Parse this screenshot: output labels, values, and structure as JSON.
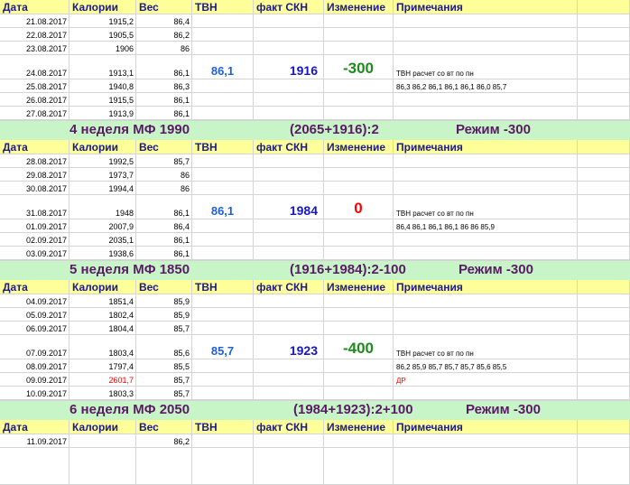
{
  "columns": [
    "Дата",
    "Калории",
    "Вес",
    "ТВН",
    "факт СКН",
    "Изменение",
    "Примечания"
  ],
  "blocks": [
    {
      "week": null,
      "rows": [
        {
          "date": "21.08.2017",
          "cal": "1915,2",
          "weight": "86,4"
        },
        {
          "date": "22.08.2017",
          "cal": "1905,5",
          "weight": "86,2"
        },
        {
          "date": "23.08.2017",
          "cal": "1906",
          "weight": "86"
        },
        {
          "date": "24.08.2017",
          "cal": "1913,1",
          "weight": "86,1",
          "tvn": "86,1",
          "skn": "1916",
          "change": "-300",
          "change_color": "green",
          "note": "ТВН расчет со вт по пн"
        },
        {
          "date": "25.08.2017",
          "cal": "1940,8",
          "weight": "86,3",
          "note": "86,3  86,2  86,1  86,1  86,1  86,0  85,7"
        },
        {
          "date": "26.08.2017",
          "cal": "1915,5",
          "weight": "86,1"
        },
        {
          "date": "27.08.2017",
          "cal": "1913,9",
          "weight": "86,1"
        }
      ]
    },
    {
      "week": {
        "title": "4 неделя МФ  1990",
        "formula": "(2065+1916):2",
        "mode": "Режим  -300"
      },
      "rows": [
        {
          "date": "28.08.2017",
          "cal": "1992,5",
          "weight": "85,7"
        },
        {
          "date": "29.08.2017",
          "cal": "1973,7",
          "weight": "86"
        },
        {
          "date": "30.08.2017",
          "cal": "1994,4",
          "weight": "86"
        },
        {
          "date": "31.08.2017",
          "cal": "1948",
          "weight": "86,1",
          "tvn": "86,1",
          "skn": "1984",
          "change": "0",
          "change_color": "red",
          "note": "ТВН расчет со вт по пн"
        },
        {
          "date": "01.09.2017",
          "cal": "2007,9",
          "weight": "86,4",
          "note": "86,4  86,1  86,1  86,1  86  86  85,9"
        },
        {
          "date": "02.09.2017",
          "cal": "2035,1",
          "weight": "86,1"
        },
        {
          "date": "03.09.2017",
          "cal": "1938,6",
          "weight": "86,1"
        }
      ]
    },
    {
      "week": {
        "title": "5 неделя МФ  1850",
        "formula": "(1916+1984):2-100",
        "mode": "Режим  -300"
      },
      "rows": [
        {
          "date": "04.09.2017",
          "cal": "1851,4",
          "weight": "85,9"
        },
        {
          "date": "05.09.2017",
          "cal": "1802,4",
          "weight": "85,9"
        },
        {
          "date": "06.09.2017",
          "cal": "1804,4",
          "weight": "85,7"
        },
        {
          "date": "07.09.2017",
          "cal": "1803,4",
          "weight": "85,6",
          "tvn": "85,7",
          "skn": "1923",
          "change": "-400",
          "change_color": "green",
          "note": "ТВН расчет со вт по пн"
        },
        {
          "date": "08.09.2017",
          "cal": "1797,4",
          "weight": "85,5",
          "note": "86,2  85,9  85,7  85,7  85,7  85,6  85,5"
        },
        {
          "date": "09.09.2017",
          "cal": "2601,7",
          "cal_red": true,
          "weight": "85,7",
          "note": "ДР",
          "note_red": true
        },
        {
          "date": "10.09.2017",
          "cal": "1803,3",
          "weight": "85,7"
        }
      ]
    },
    {
      "week": {
        "title": "6  неделя МФ  2050",
        "formula": "(1984+1923):2+100",
        "mode": "Режим  -300"
      },
      "rows": [
        {
          "date": "11.09.2017",
          "cal": "",
          "weight": "86,2"
        }
      ]
    }
  ]
}
